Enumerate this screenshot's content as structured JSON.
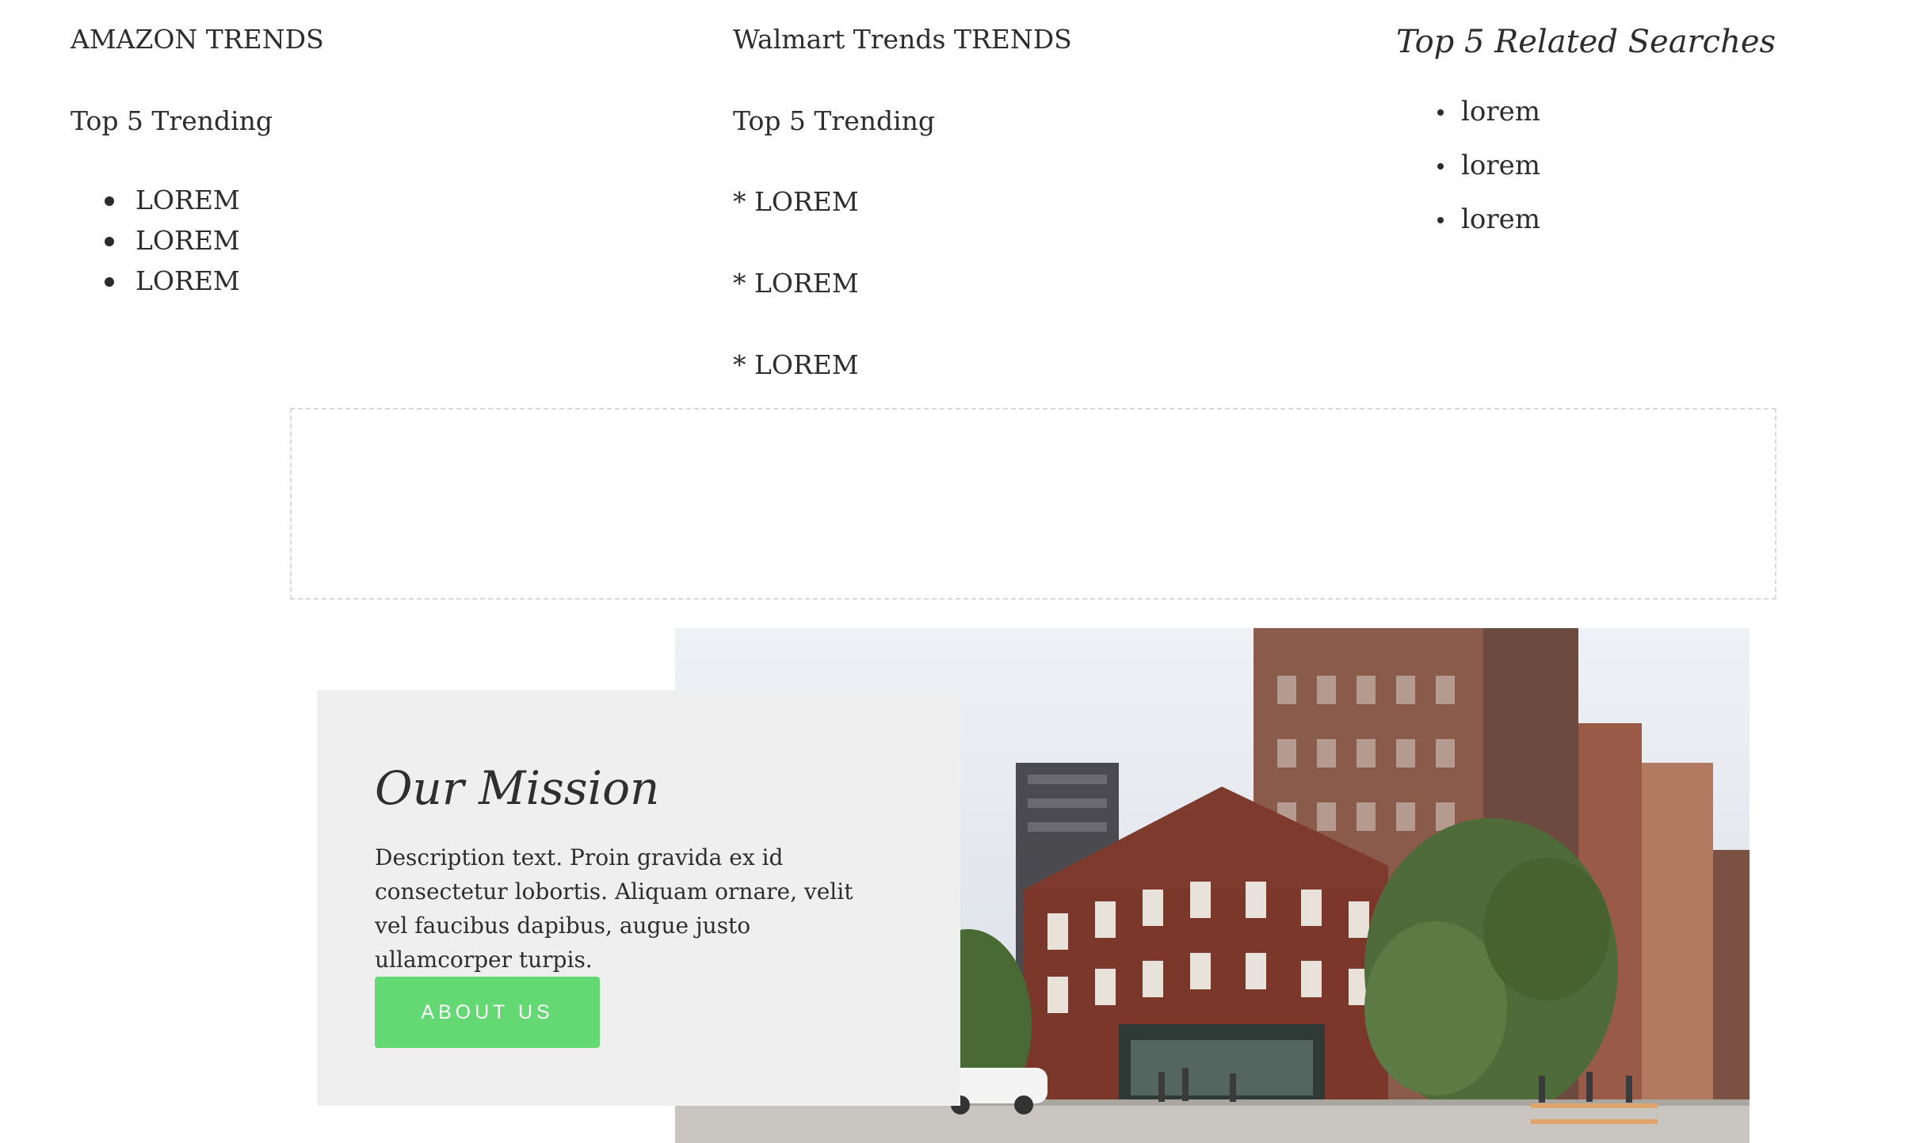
{
  "amazon": {
    "heading": "AMAZON TRENDS",
    "subheading": "Top 5 Trending",
    "items": [
      "LOREM",
      "LOREM",
      "LOREM"
    ]
  },
  "walmart": {
    "heading": "Walmart Trends TRENDS",
    "subheading": "Top 5 Trending",
    "items": [
      "* LOREM",
      "* LOREM",
      "* LOREM"
    ]
  },
  "related": {
    "heading": "Top 5 Related Searches",
    "items": [
      "lorem",
      "lorem",
      "lorem"
    ]
  },
  "mission": {
    "title": "Our Mission",
    "description": "Description text. Proin gravida ex id consectetur lobortis. Aliquam ornare, velit vel faucibus dapibus, augue justo ullamcorper turpis.",
    "button_label": "ABOUT US"
  },
  "colors": {
    "button": "#63d873",
    "card": "#efefef",
    "dashed_border": "#d8d8d8"
  }
}
